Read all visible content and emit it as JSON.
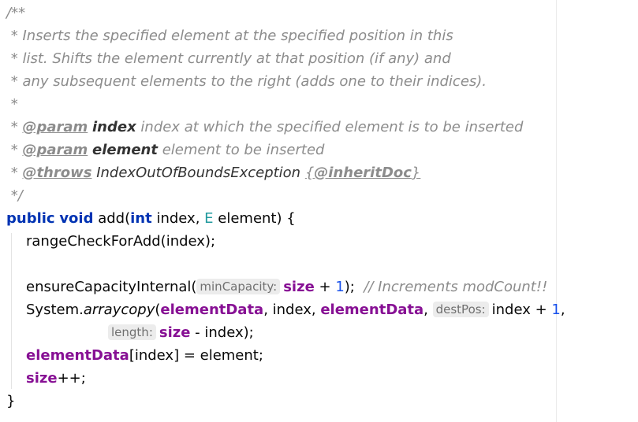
{
  "javadoc": {
    "open": "/**",
    "line1": " * Inserts the specified element at the specified position in this",
    "line2": " * list. Shifts the element currently at that position (if any) and",
    "line3": " * any subsequent elements to the right (adds one to their indices).",
    "blank": " *",
    "star": " * ",
    "param_tag": "@param",
    "param1_name": "index",
    "param1_desc": " index at which the specified element is to be inserted",
    "param2_name": "element",
    "param2_desc": " element to be inserted",
    "throws_tag": "@throws",
    "throws_type": "IndexOutOfBoundsException",
    "inherit_open": "{",
    "inherit_tag": "@inheritDoc",
    "inherit_close": "}",
    "close": " */"
  },
  "signature": {
    "kw_public": "public",
    "kw_void": "void",
    "method_open": "add(",
    "kw_int": "int",
    "param1": "index, ",
    "type_e": "E",
    "param2": "element) {"
  },
  "body": {
    "range_check": "rangeCheckForAdd(index);",
    "ensure_call": "ensureCapacityInternal(",
    "hint_min_capacity": "minCapacity:",
    "field_size": "size",
    "plus": " + ",
    "one": "1",
    "ensure_end": ");",
    "ensure_comment": "// Increments modCount!!",
    "system": "System.",
    "arraycopy": "arraycopy",
    "paren_open": "(",
    "field_element_data": "elementData",
    "comma_index": ", index, ",
    "comma": ", ",
    "hint_dest_pos": "destPos:",
    "index_plus": "index + ",
    "comma_end": ",",
    "hint_length": "length:",
    "size_minus": " - index);",
    "assign_index": "[index] = element;",
    "size_inc": "++;",
    "close_brace": "}"
  }
}
